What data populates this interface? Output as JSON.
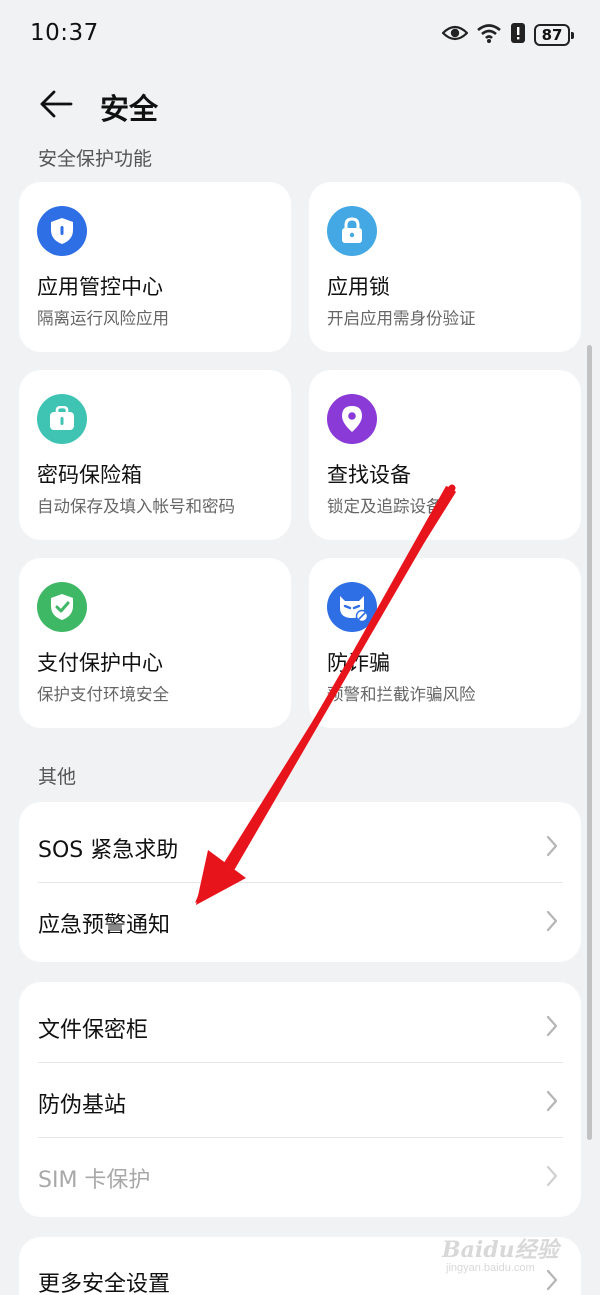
{
  "status_bar": {
    "time": "10:37",
    "battery": "87",
    "icons": [
      "eye-icon",
      "wifi-icon",
      "alert-icon",
      "battery-icon"
    ]
  },
  "header": {
    "title": "安全",
    "back_icon": "back-arrow-icon"
  },
  "sections": {
    "protection_label": "安全保护功能",
    "other_label": "其他"
  },
  "features": [
    {
      "title": "应用管控中心",
      "desc": "隔离运行风险应用",
      "icon": "shield-icon",
      "color": "#2f6fe6"
    },
    {
      "title": "应用锁",
      "desc": "开启应用需身份验证",
      "icon": "lock-icon",
      "color": "#44a8e4"
    },
    {
      "title": "密码保险箱",
      "desc": "自动保存及填入帐号和密码",
      "icon": "safe-icon",
      "color": "#3fc4b4"
    },
    {
      "title": "查找设备",
      "desc": "锁定及追踪设备",
      "icon": "location-pin-icon",
      "color": "#8a3ad6"
    },
    {
      "title": "支付保护中心",
      "desc": "保护支付环境安全",
      "icon": "check-shield-icon",
      "color": "#3fb866"
    },
    {
      "title": "防诈骗",
      "desc": "预警和拦截诈骗风险",
      "icon": "anti-fraud-icon",
      "color": "#2f6fe6"
    }
  ],
  "group1": [
    {
      "label": "SOS 紧急求助"
    },
    {
      "label": "应急预警通知"
    }
  ],
  "group2": [
    {
      "label": "文件保密柜"
    },
    {
      "label": "防伪基站"
    },
    {
      "label": "SIM 卡保护"
    }
  ],
  "group3": [
    {
      "label": "更多安全设置"
    }
  ],
  "watermark": {
    "main": "Baidu经验",
    "sub": "jingyan.baidu.com"
  },
  "colors": {
    "background": "#f1f2f4",
    "card": "#ffffff",
    "annotation_arrow": "#e8141c"
  }
}
